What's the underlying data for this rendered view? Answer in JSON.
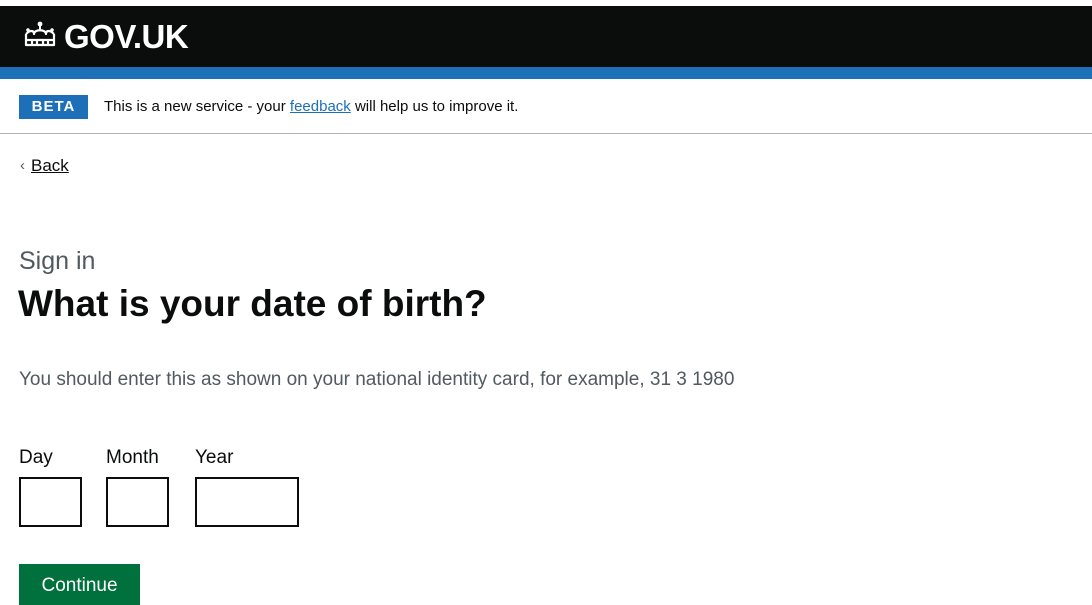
{
  "header": {
    "logo_text": "GOV.UK",
    "logo_icon": "crown-icon"
  },
  "phase_banner": {
    "tag": "BETA",
    "text_before": "This is a new service - your",
    "link_text": "feedback",
    "text_after": "will help us to improve it."
  },
  "back_link": {
    "icon": "chevron-left-icon",
    "label": "Back"
  },
  "question": {
    "caption": "Sign in",
    "title": "What is your date of birth?",
    "hint": "You should enter this as shown on your national identity card, for example, 31 3 1980"
  },
  "date_fields": {
    "day_label": "Day",
    "day_value": "",
    "month_label": "Month",
    "month_value": "",
    "year_label": "Year",
    "year_value": ""
  },
  "actions": {
    "continue_label": "Continue"
  },
  "colors": {
    "header_bg": "#0b0c0c",
    "brand_blue": "#1d70b8",
    "button_green": "#00703c",
    "hint_grey": "#505a5f"
  }
}
